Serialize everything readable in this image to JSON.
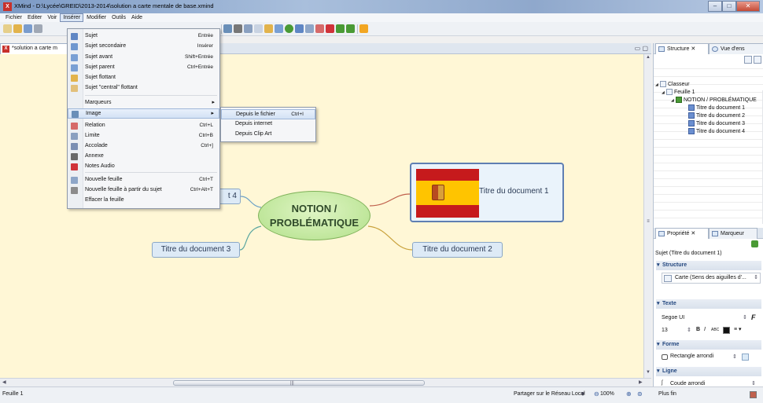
{
  "window": {
    "title": "XMind - D:\\Lycée\\GREID\\2013-2014\\solution a carte mentale de base.xmind",
    "controls": [
      "–",
      "□",
      "✕"
    ]
  },
  "menubar": [
    "Fichier",
    "Editer",
    "Voir",
    "Insérer",
    "Modifier",
    "Outils",
    "Aide"
  ],
  "editor": {
    "tab_label": "*solution a carte m"
  },
  "menu_inserer": {
    "items": [
      {
        "label": "Sujet",
        "shortcut": "Entrée",
        "icon": "topic-icon",
        "color": "#5f86c4"
      },
      {
        "label": "Sujet secondaire",
        "shortcut": "Insérer",
        "icon": "subtopic-icon",
        "color": "#6f97cf"
      },
      {
        "label": "Sujet avant",
        "shortcut": "Shift+Entrée",
        "icon": "topic-before-icon",
        "color": "#7aa0d4"
      },
      {
        "label": "Sujet parent",
        "shortcut": "Ctrl+Entrée",
        "icon": "parent-topic-icon",
        "color": "#7aa0d4"
      },
      {
        "label": "Sujet flottant",
        "shortcut": "",
        "icon": "floating-topic-icon",
        "color": "#e2b34c"
      },
      {
        "label": "Sujet \"central\" flottant",
        "shortcut": "",
        "icon": "floating-central-topic-icon",
        "color": "#e2c07a"
      },
      {
        "label": "Marqueurs",
        "shortcut": "",
        "icon": "",
        "color": ""
      },
      {
        "label": "Image",
        "shortcut": "",
        "icon": "image-icon",
        "color": "#6a8fb8"
      },
      {
        "label": "Relation",
        "shortcut": "Ctrl+L",
        "icon": "relation-icon",
        "color": "#d66a6a"
      },
      {
        "label": "Limite",
        "shortcut": "Ctrl+B",
        "icon": "boundary-icon",
        "color": "#8aa0c0"
      },
      {
        "label": "Accolade",
        "shortcut": "Ctrl+]",
        "icon": "summary-icon",
        "color": "#7b8fb3"
      },
      {
        "label": "Annexe",
        "shortcut": "",
        "icon": "attachment-icon",
        "color": "#6a6a6a"
      },
      {
        "label": "Notes Audio",
        "shortcut": "",
        "icon": "audio-notes-icon",
        "color": "#d0333a"
      },
      {
        "label": "Nouvelle feuille",
        "shortcut": "Ctrl+T",
        "icon": "new-sheet-icon",
        "color": "#8ea6c8"
      },
      {
        "label": "Nouvelle feuille à partir du sujet",
        "shortcut": "Ctrl+Alt+T",
        "icon": "sheet-from-topic-icon",
        "color": "#8c8c8c"
      },
      {
        "label": "Effacer la feuille",
        "shortcut": "",
        "icon": "",
        "color": ""
      }
    ]
  },
  "submenu_image": {
    "items": [
      {
        "label": "Depuis le fichier",
        "shortcut": "Ctrl+I"
      },
      {
        "label": "Depuis internet",
        "shortcut": ""
      },
      {
        "label": "Depuis Clip Art",
        "shortcut": ""
      }
    ]
  },
  "map": {
    "central_line1": "NOTION /",
    "central_line2": "PROBLÉMATIQUE",
    "topic_1": "Titre du document  1",
    "topic_2": "Titre du document  2",
    "topic_3": "Titre du document  3",
    "topic_4": "t  4"
  },
  "right_panel": {
    "tabs": [
      "Structure",
      "Vue d'ens"
    ],
    "tree": [
      {
        "label": "Classeur",
        "level": 0,
        "icon": "workbook-icon"
      },
      {
        "label": "Feuille 1",
        "level": 1,
        "icon": "sheet-icon"
      },
      {
        "label": "NOTION /  PROBLÉMATIQUE",
        "level": 2,
        "icon": "central-topic-icon"
      },
      {
        "label": "Titre du document 1",
        "level": 3,
        "icon": "topic-icon"
      },
      {
        "label": "Titre du document 2",
        "level": 3,
        "icon": "topic-icon"
      },
      {
        "label": "Titre du document 3",
        "level": 3,
        "icon": "topic-icon"
      },
      {
        "label": "Titre du document 4",
        "level": 3,
        "icon": "topic-icon"
      }
    ],
    "prop_tabs": [
      "Propriété",
      "Marqueur"
    ],
    "prop_title": "Sujet (Titre du document 1)",
    "sections": {
      "structure": "Structure",
      "structure_value": "Carte (Sens des aiguilles d'...",
      "texte": "Texte",
      "font": "Segoe UI",
      "size": "13",
      "forme": "Forme",
      "shape": "Rectangle arrondi",
      "ligne": "Ligne",
      "line_style": "Coude arrondi",
      "line_width": "Plus fin"
    }
  },
  "status": {
    "sheet": "Feuille 1",
    "share": "Partager sur le Réseau Local",
    "zoom": "100%"
  },
  "colors": {
    "canvas": "#fff7d6",
    "central": "#b2e08a",
    "topic": "#ddeaf6",
    "selected_border": "#5f7fb2"
  }
}
